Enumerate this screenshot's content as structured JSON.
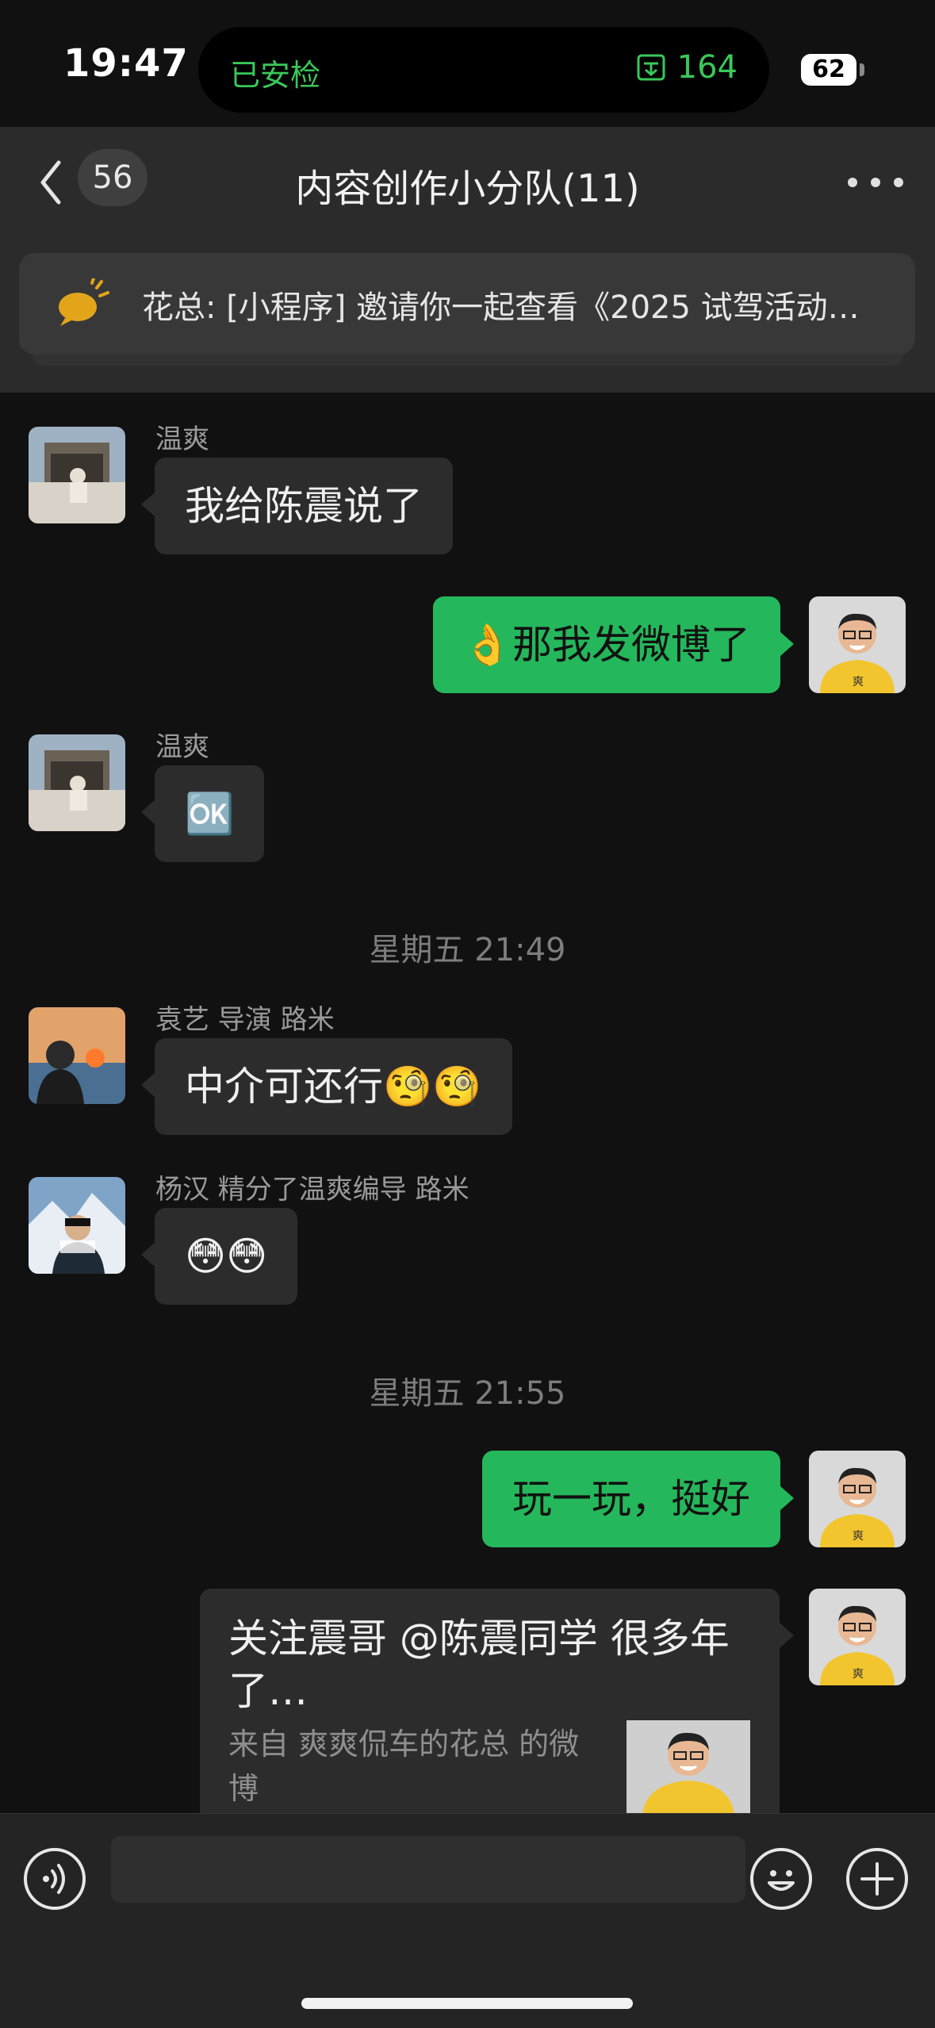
{
  "status_bar": {
    "time": "19:47",
    "security_label": "已安检",
    "steps": "164",
    "battery": "62"
  },
  "header": {
    "unread_count": "56",
    "title": "内容创作小分队(11)"
  },
  "pinned": {
    "text": "花总: [小程序] 邀请你一起查看《2025 试驾活动…"
  },
  "messages": [
    {
      "sender": "温爽",
      "text": "我给陈震说了",
      "direction": "in"
    },
    {
      "text": "👌那我发微博了",
      "direction": "out"
    },
    {
      "sender": "温爽",
      "text": "🆗",
      "direction": "in"
    },
    {
      "sender": "袁艺 导演 路米",
      "text": "中介可还行🧐🧐",
      "direction": "in"
    },
    {
      "sender": "杨汉  精分了温爽编导 路米",
      "text": "😳😳",
      "direction": "in"
    },
    {
      "text": "玩一玩，挺好",
      "direction": "out"
    }
  ],
  "timestamps": [
    "星期五 21:49",
    "星期五 21:55"
  ],
  "share_card": {
    "title": "关注震哥 @陈震同学 很多年了…",
    "source": "来自 爽爽侃车的花总 的微博"
  },
  "colors": {
    "background": "#111111",
    "bubble_in": "#2c2c2c",
    "bubble_out": "#25b75b",
    "accent_green": "#3ac75a"
  },
  "icons": [
    "back-arrow-icon",
    "more-dots-icon",
    "megaphone-icon",
    "voice-icon",
    "emoji-icon",
    "plus-icon",
    "steps-icon"
  ]
}
